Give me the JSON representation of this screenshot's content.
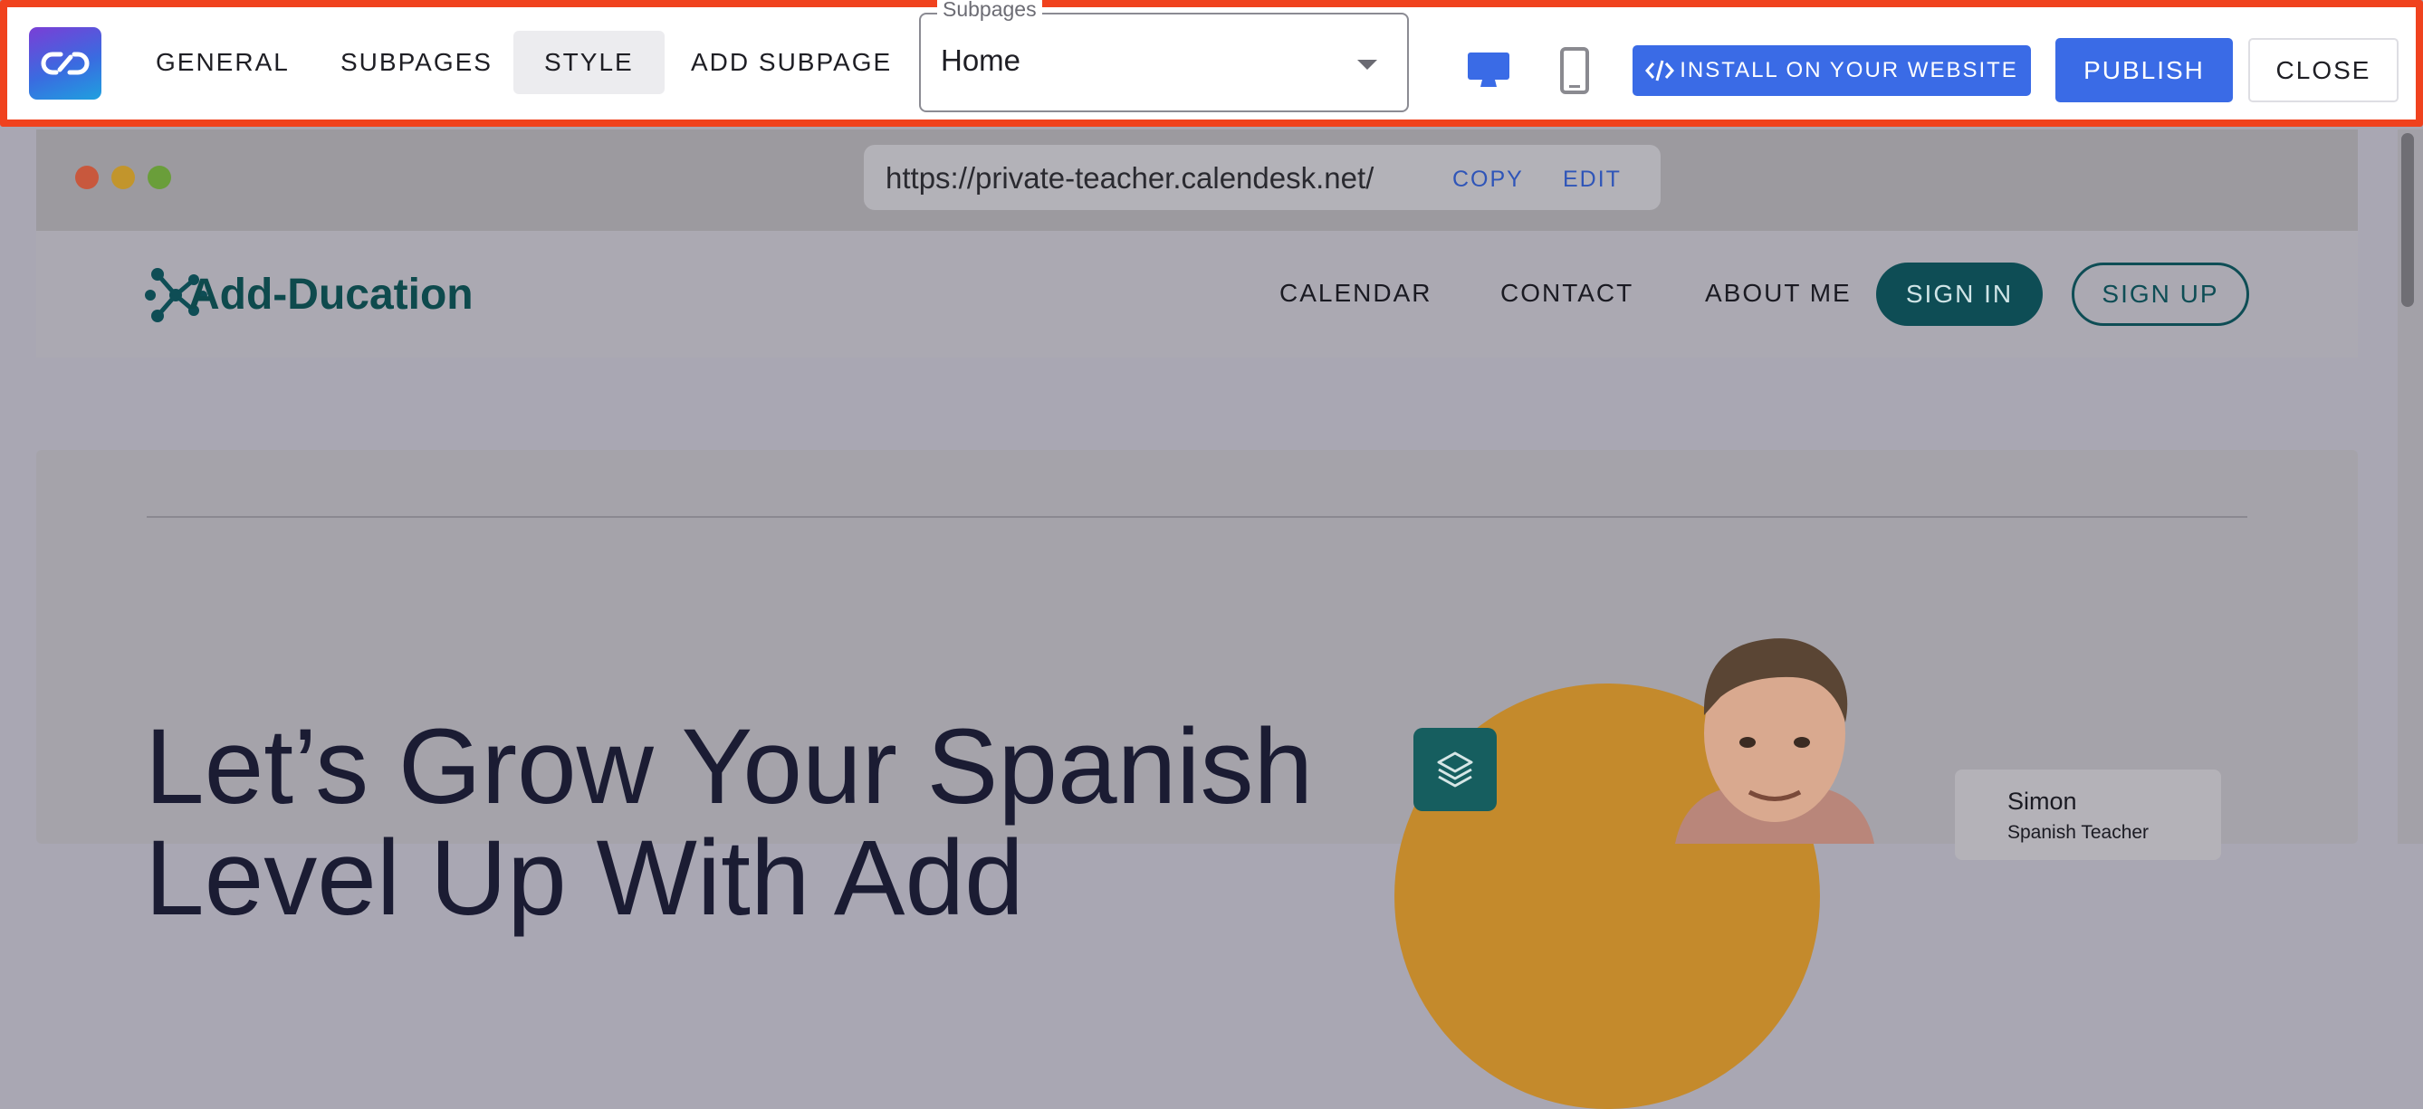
{
  "toolbar": {
    "tabs": [
      {
        "label": "GENERAL"
      },
      {
        "label": "SUBPAGES"
      },
      {
        "label": "STYLE"
      },
      {
        "label": "ADD SUBPAGE"
      }
    ],
    "active_tab": "STYLE",
    "subpages_select": {
      "label": "Subpages",
      "value": "Home"
    },
    "device_icons": [
      "desktop-icon",
      "mobile-icon"
    ],
    "install_label": "INSTALL ON YOUR WEBSITE",
    "publish_label": "PUBLISH",
    "close_label": "CLOSE",
    "accent_color": "#3a6be6",
    "highlight_border_color": "#f0421e"
  },
  "browser": {
    "url": "https://private-teacher.calendesk.net/",
    "copy_label": "COPY",
    "edit_label": "EDIT"
  },
  "site": {
    "brand": "Add-Ducation",
    "nav": [
      "CALENDAR",
      "CONTACT",
      "ABOUT ME"
    ],
    "sign_in_label": "SIGN IN",
    "sign_up_label": "SIGN UP",
    "hero_line1": "Let’s Grow Your Spanish",
    "hero_line2": "Level Up With Add",
    "teacher_name": "Simon",
    "teacher_role": "Spanish Teacher",
    "brand_color": "#0e4d55"
  }
}
